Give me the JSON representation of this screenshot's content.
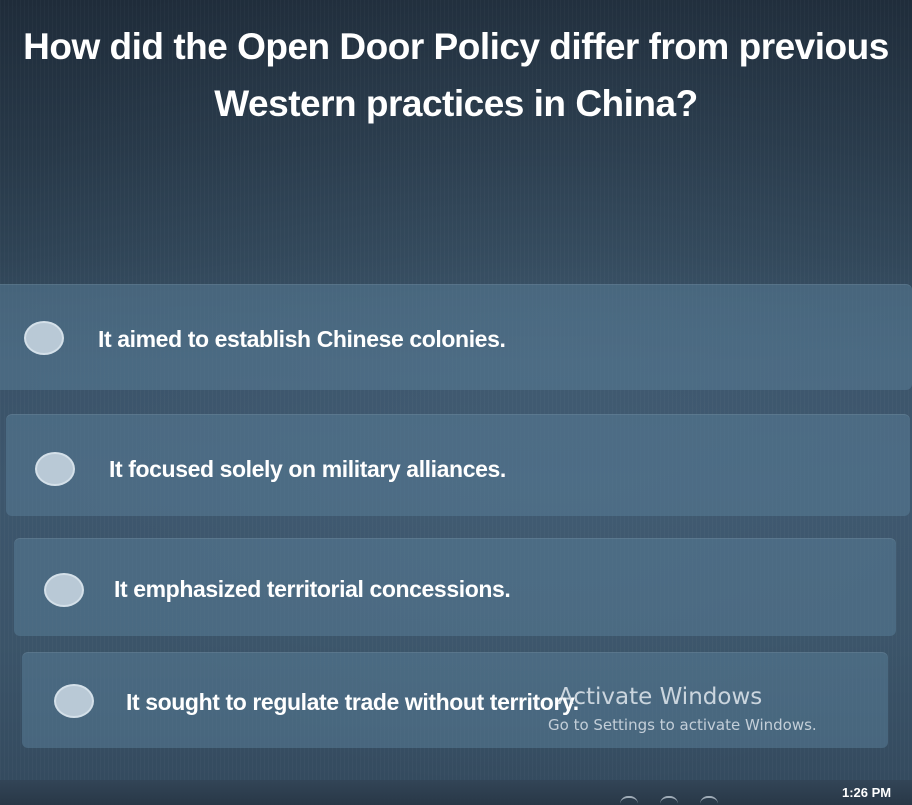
{
  "question": {
    "text": "How did the Open Door Policy differ from previous Western practices in China?"
  },
  "options": [
    {
      "label": "It aimed to establish Chinese colonies."
    },
    {
      "label": "It focused solely on military alliances."
    },
    {
      "label": "It emphasized territorial concessions."
    },
    {
      "label": "It sought to regulate trade without territory."
    }
  ],
  "watermark": {
    "title": "Activate Windows",
    "subtitle": "Go to Settings to activate Windows."
  },
  "taskbar": {
    "time": "1:26 PM",
    "tray_icons": [
      "wifi-icon",
      "volume-icon",
      "network-icon"
    ]
  },
  "colors": {
    "background": "#34495e",
    "option_fill": "#587c96",
    "radio_fill": "#b9c9d6",
    "text": "#ffffff"
  }
}
